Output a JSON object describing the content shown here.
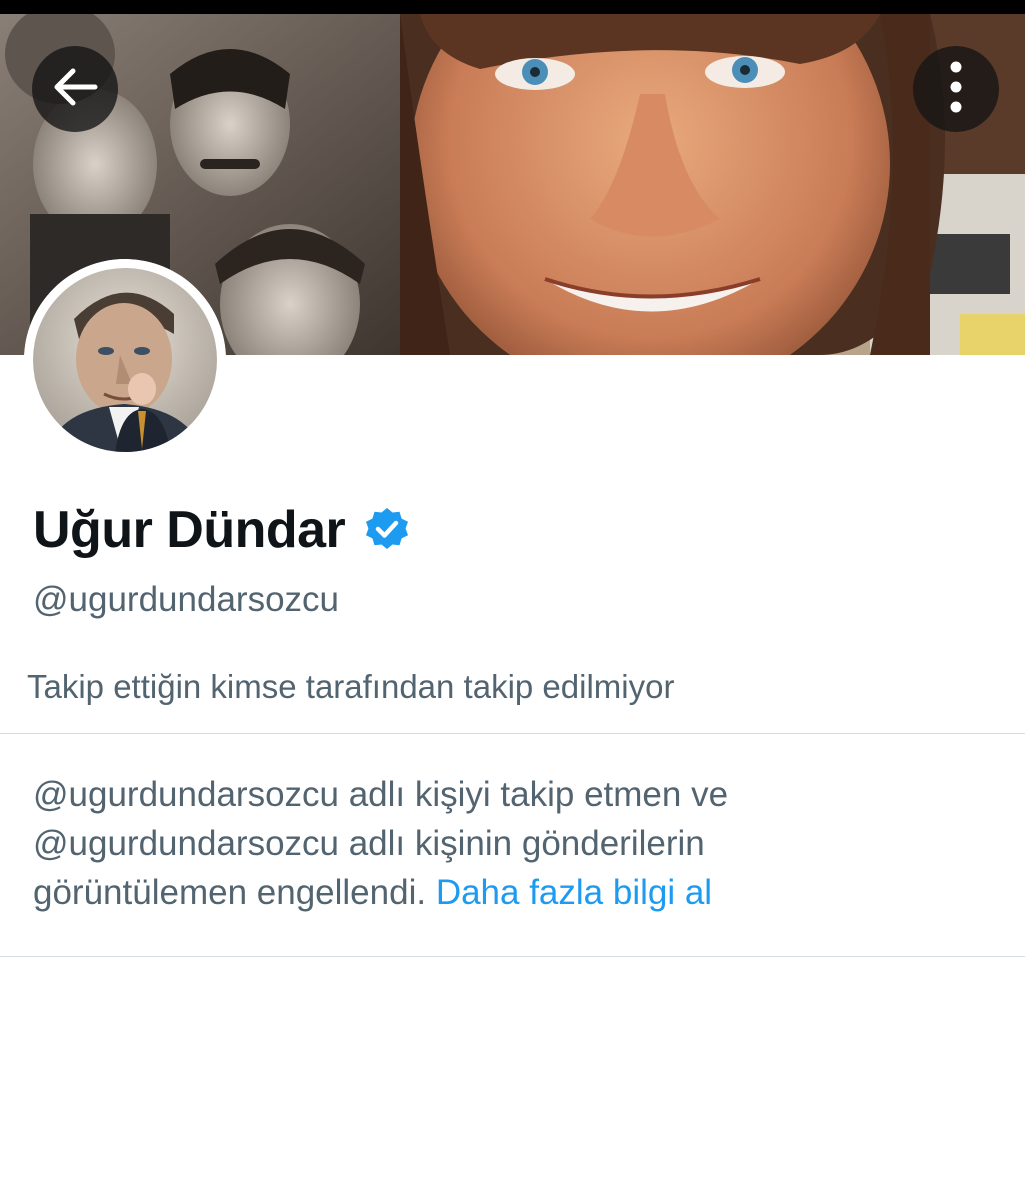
{
  "profile": {
    "display_name": "Uğur Dündar",
    "handle": "@ugurdundarsozcu",
    "verified": true,
    "follow_note": "Takip ettiğin kimse tarafından takip edilmiyor"
  },
  "notice": {
    "line_1": "@ugurdundarsozcu adlı kişiyi takip etmen ve",
    "line_2": "@ugurdundarsozcu adlı kişinin gönderilerin",
    "line_3": "görüntülemen engellendi.",
    "learn_more": "Daha fazla bilgi al"
  },
  "icons": {
    "back": "arrow-left-icon",
    "more": "vertical-dots-icon",
    "verified": "verified-badge-icon"
  },
  "colors": {
    "text_primary": "#0f1419",
    "text_secondary": "#536471",
    "link": "#1d9bf0",
    "verified": "#1d9bf0"
  }
}
